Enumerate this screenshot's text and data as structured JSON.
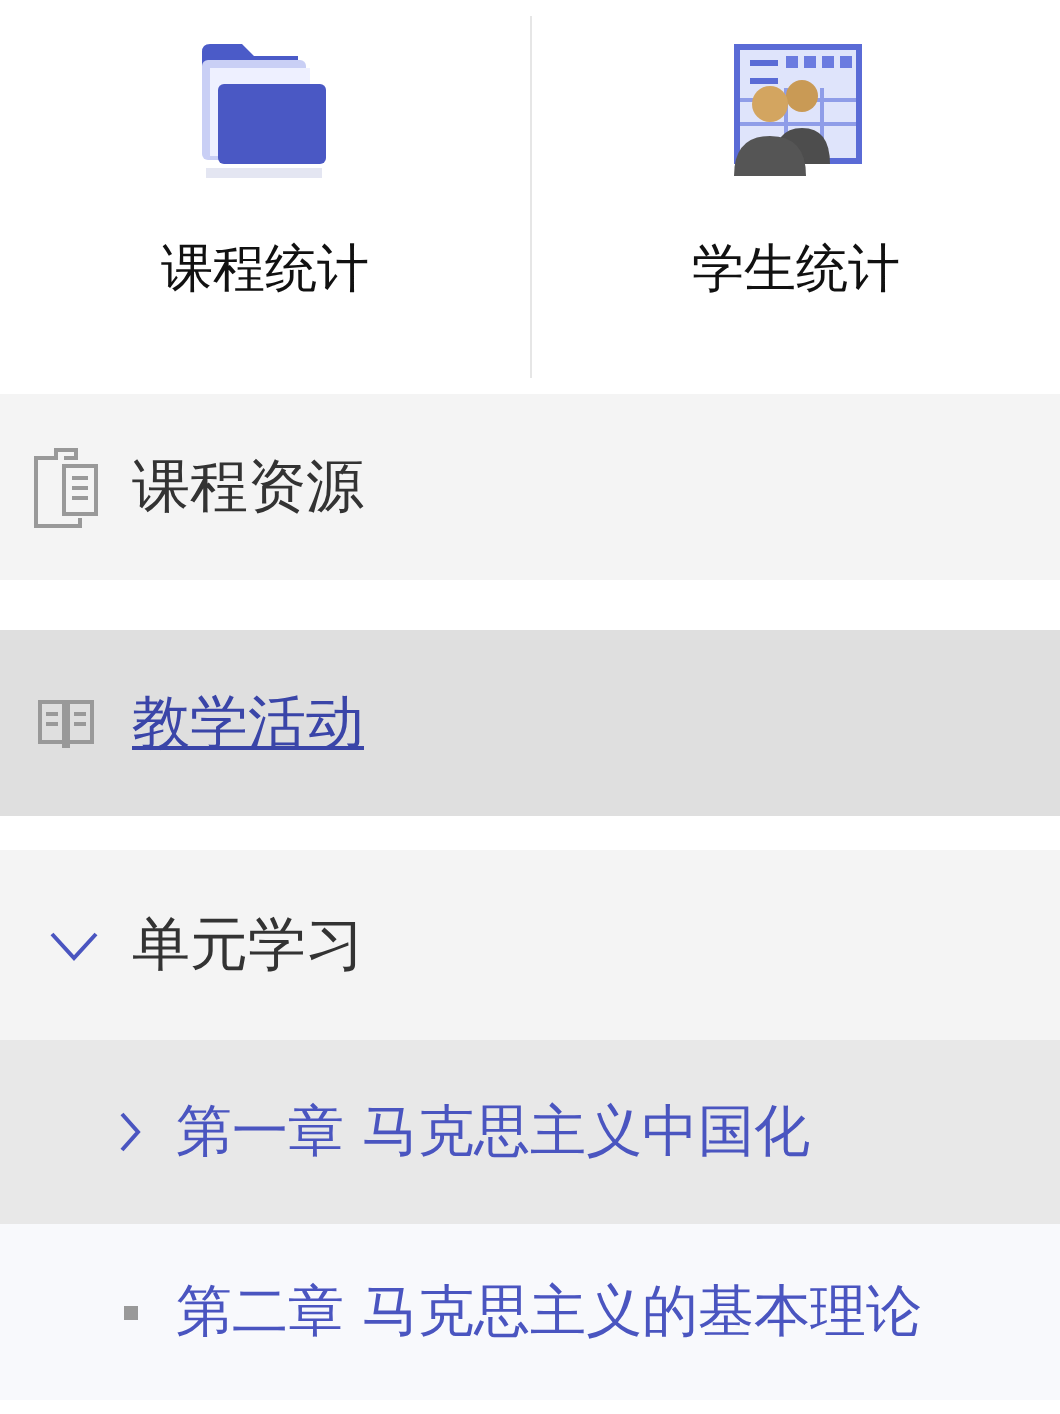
{
  "toolbar": [
    {
      "label": "课程统计",
      "kind": "folder"
    },
    {
      "label": "学生统计",
      "kind": "students"
    }
  ],
  "menu": [
    {
      "label": "课程资源",
      "kind": "clipboard",
      "selected": false
    },
    {
      "label": "教学活动",
      "kind": "book",
      "selected": true
    }
  ],
  "unit": {
    "label": "单元学习",
    "expanded": true,
    "children": [
      {
        "label": "第一章 马克思主义中国化",
        "kind": "expandable",
        "selected": true
      },
      {
        "label": "第二章 马克思主义的基本理论",
        "kind": "leaf",
        "selected": false
      }
    ]
  }
}
